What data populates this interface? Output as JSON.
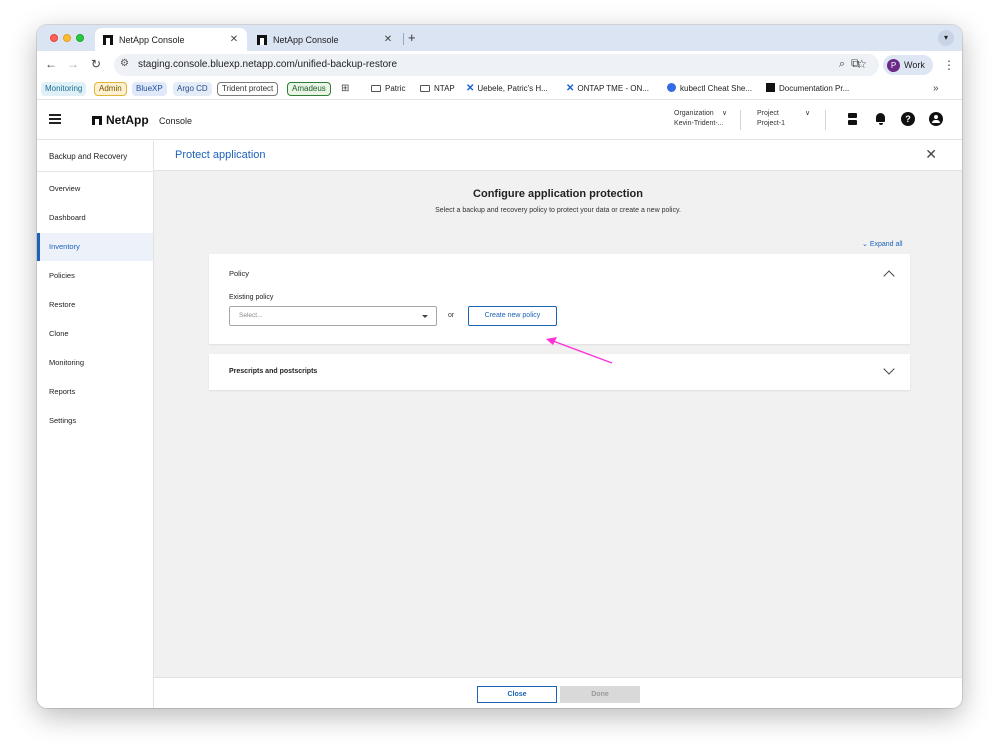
{
  "browser": {
    "tabs": [
      {
        "title": "NetApp Console",
        "close": "✕"
      },
      {
        "title": "NetApp Console",
        "close": "✕"
      }
    ],
    "new_tab": "+",
    "url": "staging.console.bluexp.netapp.com/unified-backup-restore",
    "profile_initial": "P",
    "profile_label": "Work"
  },
  "bookmarks": [
    "Monitoring",
    "Admin",
    "BlueXP",
    "Argo CD",
    "Trident protect",
    "Amadeus",
    "Patric",
    "NTAP",
    "Uebele, Patric's H...",
    "ONTAP TME - ON...",
    "kubectl Cheat She...",
    "Documentation Pr..."
  ],
  "header": {
    "brand": "NetApp",
    "console_label": "Console",
    "organization_label": "Organization",
    "organization_value": "Kevin-Trident-...",
    "project_label": "Project",
    "project_value": "Project-1",
    "help_glyph": "?"
  },
  "sidebar": {
    "title": "Backup and Recovery",
    "items": [
      {
        "label": "Overview",
        "active": false
      },
      {
        "label": "Dashboard",
        "active": false
      },
      {
        "label": "Inventory",
        "active": true
      },
      {
        "label": "Policies",
        "active": false
      },
      {
        "label": "Restore",
        "active": false
      },
      {
        "label": "Clone",
        "active": false
      },
      {
        "label": "Monitoring",
        "active": false
      },
      {
        "label": "Reports",
        "active": false
      },
      {
        "label": "Settings",
        "active": false
      }
    ]
  },
  "main": {
    "title": "Protect application",
    "heading": "Configure application protection",
    "subheading": "Select a backup and recovery policy to protect your data or create a new policy.",
    "expand_all": "Expand all",
    "policy_section": {
      "title": "Policy",
      "existing_label": "Existing policy",
      "select_placeholder": "Select...",
      "or_text": "or",
      "create_button": "Create new policy"
    },
    "scripts_section": {
      "title": "Prescripts and postscripts"
    }
  },
  "footer": {
    "close_label": "Close",
    "done_label": "Done",
    "done_disabled": true
  },
  "colors": {
    "accent": "#1c62b9",
    "annotation_arrow": "#ff2fd8"
  }
}
